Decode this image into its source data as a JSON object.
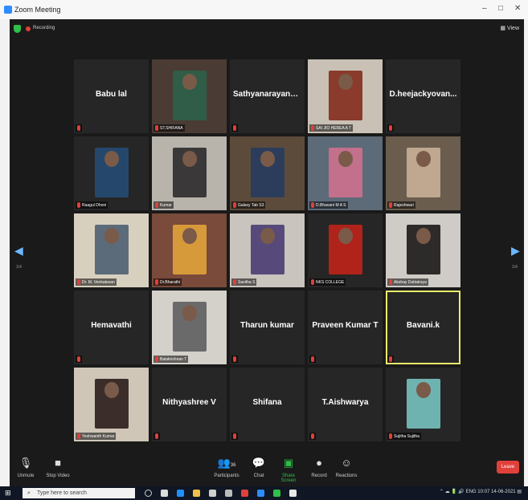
{
  "window": {
    "title": "Zoom Meeting"
  },
  "topbar": {
    "recording_label": "Recording",
    "view_label": "View"
  },
  "pages": {
    "left": "1/4",
    "right": "1/4"
  },
  "participants": [
    {
      "name": "Babu lal",
      "has_video": false
    },
    {
      "name": "ST.SHIFANA",
      "has_video": true,
      "bg": "#4a3c35",
      "photo": "#2f5d47"
    },
    {
      "name": "Sathyanarayana...",
      "has_video": false
    },
    {
      "name": "SAI JIO HEREA A T",
      "has_video": true,
      "bg": "#c9c1b5",
      "photo": "#8a3b2b"
    },
    {
      "name": "D.heejackyovan...",
      "has_video": false
    },
    {
      "name": "Raagul Dhoni",
      "has_video": true,
      "bg": "#262626",
      "photo": "#25476b"
    },
    {
      "name": "Kumar",
      "has_video": true,
      "bg": "#b8b4ac",
      "photo": "#3a3838"
    },
    {
      "name": "Galaxy Tab S3",
      "has_video": true,
      "bg": "#5c4b3b",
      "photo": "#2c3d5c"
    },
    {
      "name": "D.Bhavani M A S",
      "has_video": true,
      "bg": "#5d6a78",
      "photo": "#c2708c"
    },
    {
      "name": "Rajeshwari",
      "has_video": true,
      "bg": "#6a5d4d",
      "photo": "#bfa88f"
    },
    {
      "name": "Dr. M. Venkatesan",
      "has_video": true,
      "bg": "#d8d0bf",
      "photo": "#5b6b7a"
    },
    {
      "name": "Dr.Bharathi",
      "has_video": true,
      "bg": "#7a4a3a",
      "photo": "#d79a3a"
    },
    {
      "name": "Savitha S",
      "has_video": true,
      "bg": "#c9c4bd",
      "photo": "#574a7a"
    },
    {
      "name": "NKS COLLEGE",
      "has_video": true,
      "bg": "#262626",
      "photo": "#b0231a"
    },
    {
      "name": "Akshay Dattatraya",
      "has_video": true,
      "bg": "#cfcbc6",
      "photo": "#2d2a2a"
    },
    {
      "name": "Hemavathi",
      "has_video": false
    },
    {
      "name": "Balakrishnan T",
      "has_video": true,
      "bg": "#d4d0ca",
      "photo": "#6a6a6a"
    },
    {
      "name": "Tharun kumar",
      "has_video": false
    },
    {
      "name": "Praveen Kumar T",
      "has_video": false
    },
    {
      "name": "Bavani.k",
      "has_video": false,
      "active_speaker": true
    },
    {
      "name": "Yeshwanth Kumar",
      "has_video": true,
      "bg": "#cfc6b8",
      "photo": "#3b2e2a"
    },
    {
      "name": "Nithyashree V",
      "has_video": false
    },
    {
      "name": "Shifana",
      "has_video": false
    },
    {
      "name": "T.Aishwarya",
      "has_video": false
    },
    {
      "name": "Sujitha Sujitha",
      "has_video": true,
      "bg": "#262626",
      "photo": "#6fb3b0"
    }
  ],
  "toolbar": {
    "unmute": "Unmute",
    "stop_video": "Stop Video",
    "participants": "Participants",
    "participants_count": "36",
    "chat": "Chat",
    "share_screen": "Share Screen",
    "record": "Record",
    "reactions": "Reactions",
    "leave": "Leave"
  },
  "taskbar": {
    "search_placeholder": "Type here to search",
    "language": "ENG",
    "time": "10:07",
    "date": "14-06-2021"
  },
  "colors": {
    "accent": "#2d8cff",
    "leave": "#e0403a",
    "active_speaker": "#e9ef6a",
    "share": "#2fbf4a"
  }
}
